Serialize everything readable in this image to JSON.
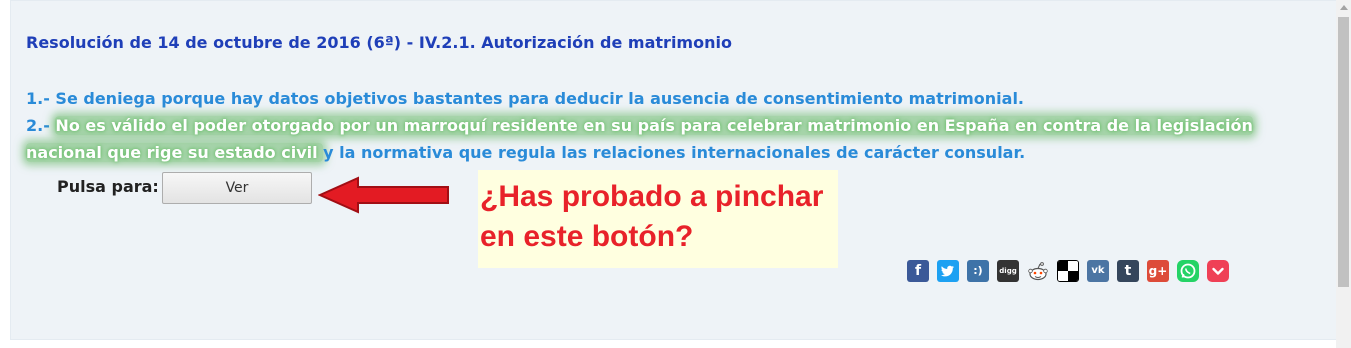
{
  "resolution": {
    "title": "Resolución de 14 de octubre de 2016 (6ª) - IV.2.1. Autorización de matrimonio"
  },
  "points": {
    "p1": "1.- Se deniega porque hay datos objetivos bastantes para deducir la ausencia de consentimiento matrimonial.",
    "p2_prefix": "2.- ",
    "p2_highlight_a": " No es válido el poder otorgado por un marroquí residente en su país para celebrar matrimonio en España en contra de la legislación",
    "p2_highlight_b": "nacional que rige su estado civil ",
    "p2_rest": " y la normativa que regula las relaciones internacionales de carácter consular."
  },
  "action": {
    "pulsa_label": "Pulsa para:",
    "ver_button": "Ver"
  },
  "callout": {
    "line1": "¿Has probado a pinchar",
    "line2": "en este botón?"
  },
  "share": {
    "icons": [
      "facebook-icon",
      "twitter-icon",
      "meneame-icon",
      "digg-icon",
      "reddit-icon",
      "delicious-icon",
      "vk-icon",
      "tumblr-icon",
      "google-plus-icon",
      "whatsapp-icon",
      "pocket-icon"
    ],
    "fb": "f",
    "md": ":)",
    "digg": "digg",
    "vk": "vk",
    "tumblr": "t",
    "gplus": "g+"
  },
  "colors": {
    "title": "#1f3fb8",
    "body_text": "#2a8bd8",
    "highlight": "#6eb96e",
    "callout_text": "#e8222a",
    "callout_bg": "#ffffe0",
    "arrow": "#e31b23"
  }
}
